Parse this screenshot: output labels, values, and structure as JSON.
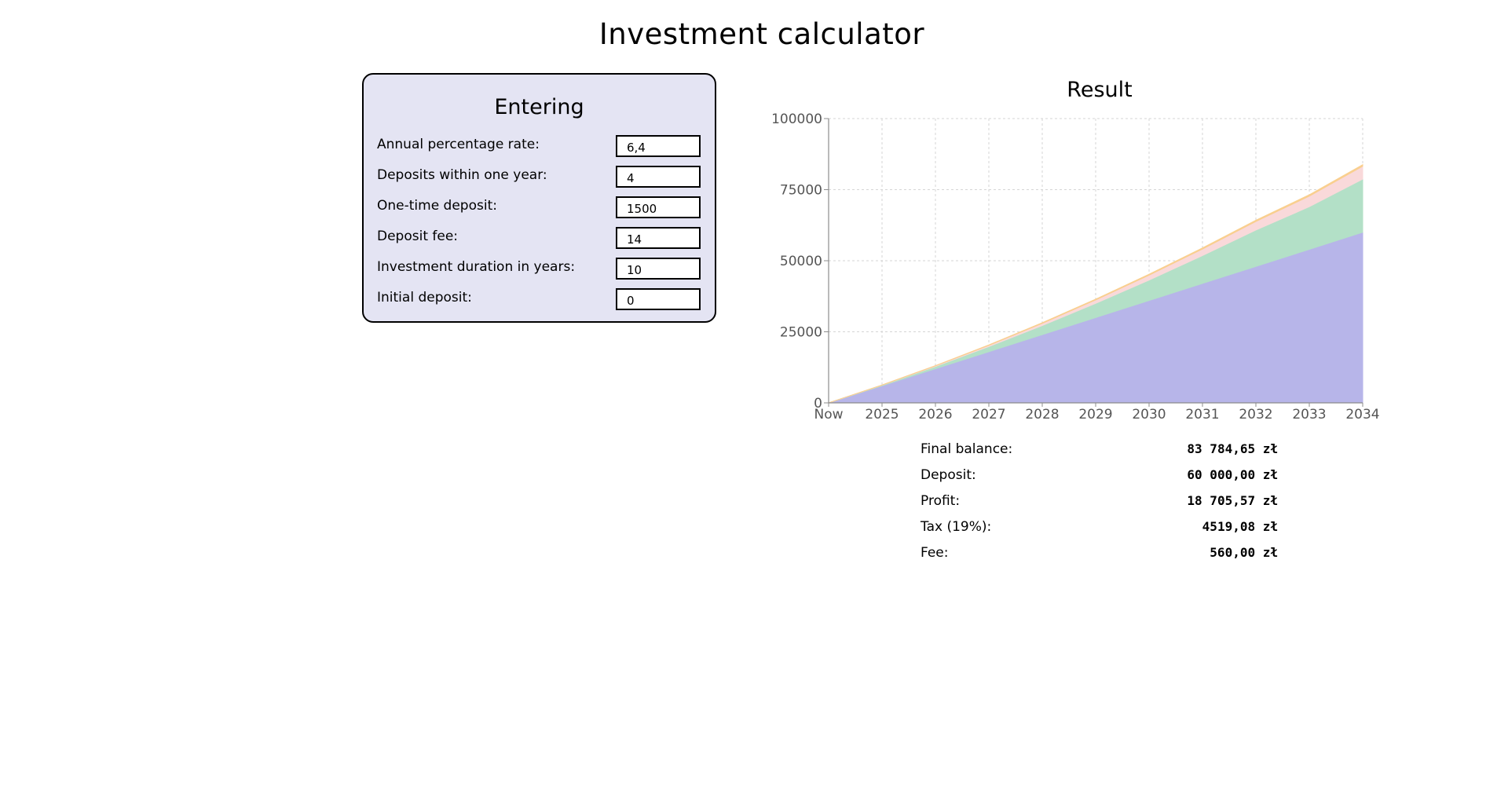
{
  "page_title": "Investment calculator",
  "form": {
    "title": "Entering",
    "fields": [
      {
        "label": "Annual percentage rate:",
        "value": "6,4"
      },
      {
        "label": "Deposits within one year:",
        "value": "4"
      },
      {
        "label": "One-time deposit:",
        "value": "1500"
      },
      {
        "label": "Deposit fee:",
        "value": "14"
      },
      {
        "label": "Investment duration in years:",
        "value": "10"
      },
      {
        "label": "Initial deposit:",
        "value": "0"
      }
    ]
  },
  "result": {
    "title": "Result",
    "summary": [
      {
        "label": "Final balance:",
        "value": "83 784,65 zł"
      },
      {
        "label": "Deposit:",
        "value": "60 000,00 zł"
      },
      {
        "label": "Profit:",
        "value": "18 705,57 zł"
      },
      {
        "label": "Tax (19%):",
        "value": "4519,08 zł"
      },
      {
        "label": "Fee:",
        "value": "560,00 zł"
      }
    ]
  },
  "chart_data": {
    "type": "area",
    "stacked": true,
    "title": "Result",
    "categories": [
      "Now",
      "2025",
      "2026",
      "2027",
      "2028",
      "2029",
      "2030",
      "2031",
      "2032",
      "2033",
      "2034"
    ],
    "yticks": [
      0,
      25000,
      50000,
      75000,
      100000
    ],
    "ylim": [
      0,
      100000
    ],
    "grid": true,
    "series": [
      {
        "color": "#b7b5e9",
        "values": [
          0,
          6000,
          12000,
          18000,
          24000,
          30000,
          36000,
          42000,
          48000,
          54000,
          60000
        ]
      },
      {
        "color": "#b3e0c7",
        "values": [
          0,
          200,
          800,
          1800,
          3200,
          5000,
          7200,
          9800,
          12800,
          15000,
          18706
        ]
      },
      {
        "color": "#f9d9da",
        "values": [
          0,
          50,
          200,
          420,
          760,
          1200,
          1700,
          2300,
          3000,
          3700,
          4519
        ]
      },
      {
        "color": "#f9cf8f",
        "values": [
          0,
          56,
          112,
          168,
          224,
          280,
          336,
          392,
          448,
          504,
          560
        ]
      }
    ]
  }
}
